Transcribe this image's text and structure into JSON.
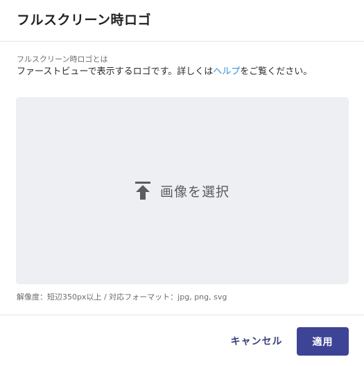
{
  "dialog": {
    "title": "フルスクリーン時ロゴ"
  },
  "info": {
    "label": "フルスクリーン時ロゴとは",
    "text_before": "ファーストビューで表示するロゴです。詳しくは",
    "help_link": "ヘルプ",
    "text_after": "をご覧ください。"
  },
  "upload": {
    "icon": "upload-icon",
    "label": "画像を選択",
    "note": "解像度：短辺350px以上 / 対応フォーマット：jpg, png, svg"
  },
  "footer": {
    "cancel_label": "キャンセル",
    "apply_label": "適用"
  },
  "colors": {
    "primary": "#3d4495",
    "link": "#2f8fe0",
    "dropzone_bg": "#eeeff3"
  }
}
